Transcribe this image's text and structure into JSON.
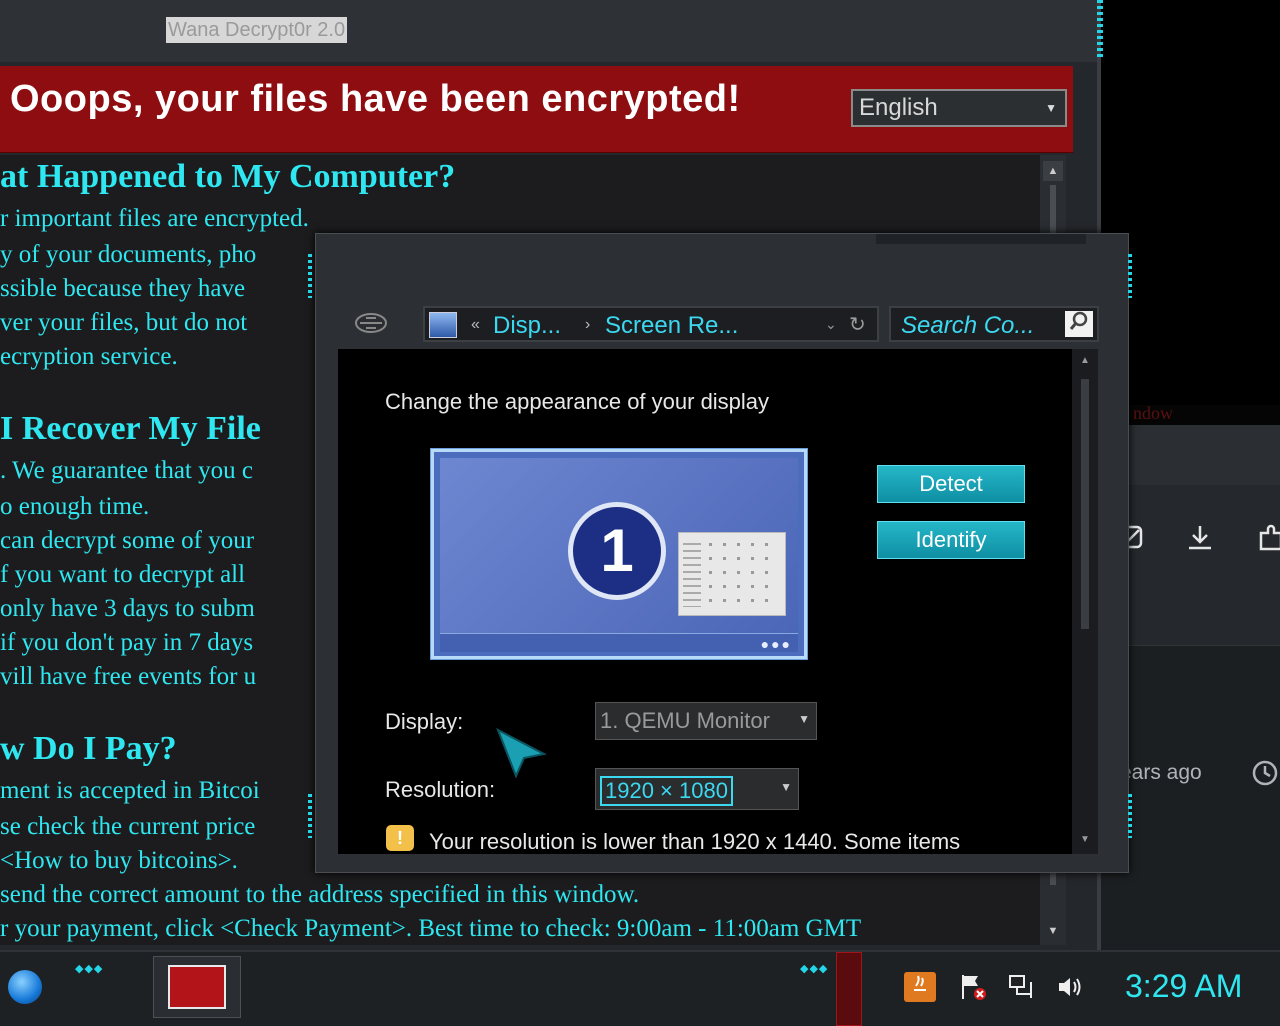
{
  "background_window": {
    "relative_time": "ears ago",
    "partial_text": "ndow"
  },
  "wanacry": {
    "title": "Wana Decrypt0r 2.0",
    "heading": "Ooops, your files have been encrypted!",
    "language": "English",
    "lines": [
      "at Happened to My Computer?",
      "r important files are encrypted.",
      "y of your documents, pho",
      "ssible because they have",
      "ver your files, but do not",
      "ecryption service.",
      "I Recover My File",
      ". We guarantee that you c",
      "o enough time.",
      "can decrypt some of your",
      "f you want to decrypt all",
      "only have 3 days to subm",
      " if you don't pay in 7 days",
      "vill have free events for u",
      "w Do I Pay?",
      "ment is accepted in Bitcoi",
      "se check the current price",
      " <How to buy bitcoins>.",
      "send the correct amount to the address specified in this window.",
      "r your payment, click <Check Payment>. Best time to check: 9:00am - 11:00am GMT"
    ]
  },
  "display_window": {
    "address_crumbs": [
      "Disp...",
      "Screen Re..."
    ],
    "crumb_prefix": "«",
    "crumb_separator": "›",
    "search_placeholder": "Search Co...",
    "heading": "Change the appearance of your display",
    "monitor_number": "1",
    "detect_label": "Detect",
    "identify_label": "Identify",
    "display_label": "Display:",
    "display_value": "1. QEMU Monitor",
    "resolution_label": "Resolution:",
    "resolution_value": "1920 × 1080",
    "warning_text": "Your resolution is lower than 1920 x 1440. Some items",
    "warning_icon": "!"
  },
  "taskbar": {
    "clock": "3:29 AM",
    "tray_icons": [
      "java-icon",
      "action-center-flag-icon",
      "network-icon",
      "volume-icon"
    ]
  },
  "colors": {
    "accent_cyan": "#2fe7f0",
    "banner_red": "#8d0d10",
    "button_teal": "#17a3b6"
  }
}
